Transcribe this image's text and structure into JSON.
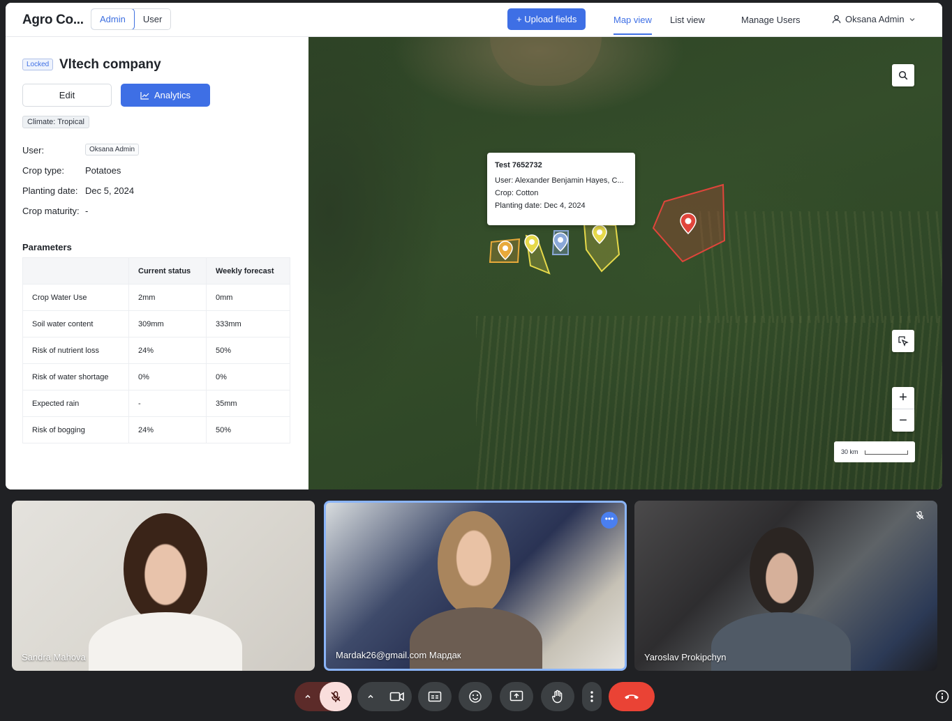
{
  "app": {
    "brand": "Agro Co...",
    "roles": [
      "Admin",
      "User"
    ],
    "upload_label": "+ Upload fields",
    "nav": [
      "Map view",
      "List view",
      "Manage Users"
    ],
    "user_menu": "Oksana Admin"
  },
  "company": {
    "locked_label": "Locked",
    "name": "Vltech company",
    "edit_label": "Edit",
    "analytics_label": "Analytics",
    "climate": "Climate: Tropical",
    "fields": [
      {
        "label": "User:",
        "value": "Oksana Admin"
      },
      {
        "label": "Crop type:",
        "value": "Potatoes"
      },
      {
        "label": "Planting date:",
        "value": "Dec 5, 2024"
      },
      {
        "label": "Crop maturity:",
        "value": "-"
      }
    ]
  },
  "parameters": {
    "title": "Parameters",
    "headers": [
      "",
      "Current status",
      "Weekly forecast"
    ],
    "rows": [
      [
        "Crop Water Use",
        "2mm",
        "0mm"
      ],
      [
        "Soil water content",
        "309mm",
        "333mm"
      ],
      [
        "Risk of nutrient loss",
        "24%",
        "50%"
      ],
      [
        "Risk of water shortage",
        "0%",
        "0%"
      ],
      [
        "Expected rain",
        "-",
        "35mm"
      ],
      [
        "Risk of bogging",
        "24%",
        "50%"
      ]
    ]
  },
  "map": {
    "popup": {
      "title": "Test 7652732",
      "user": "User: Alexander Benjamin Hayes, C...",
      "crop": "Crop: Cotton",
      "planting": "Planting date: Dec 4, 2024"
    },
    "scale_label": "30 km",
    "field_colors": {
      "orange": "#e8a93a",
      "yellow": "#e6d94a",
      "blue": "#8aa8d8",
      "red": "#e0453b"
    }
  },
  "meet": {
    "participants": [
      "Sandra Mahova",
      "Mardak26@gmail.com Мардак",
      "Yaroslav Prokipchyn"
    ],
    "options_glyph": "•••",
    "accent": "#8ab4f8",
    "end_call_color": "#ea4335"
  }
}
